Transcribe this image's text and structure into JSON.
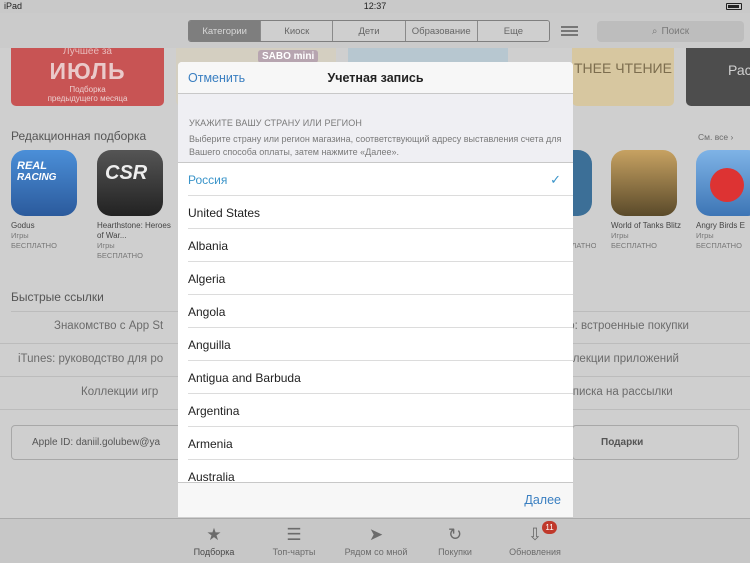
{
  "status": {
    "device": "iPad",
    "time": "12:37"
  },
  "nav": {
    "segments": [
      "Категории",
      "Киоск",
      "Дети",
      "Образование",
      "Еще"
    ],
    "active_segment": 0,
    "search_placeholder": "Поиск"
  },
  "banners": {
    "red_top": "Лучшее за",
    "red_title": "ИЮЛЬ",
    "red_sub1": "Подборка",
    "red_sub2": "предыдущего месяца",
    "sabo": "SABO mini",
    "reading": "ТНЕЕ ЧТЕНИЕ",
    "far": "Рас"
  },
  "editors": {
    "title": "Редакционная подборка",
    "see_all": "См. все ›",
    "apps": [
      {
        "name": "Godus",
        "cat": "Игры",
        "price": "БЕСПЛАТНО",
        "color": "#3a74c4"
      },
      {
        "name": "Hearthstone: Heroes of War...",
        "cat": "Игры",
        "price": "БЕСПЛАТНО",
        "color": "#3b3b3b"
      },
      {
        "name": "World of Tanks Blitz",
        "cat": "Игры",
        "price": "БЕСПЛАТНО",
        "color": "#7a6a3c"
      },
      {
        "name": "Angry Birds E",
        "cat": "Игры",
        "price": "БЕСПЛАТНО",
        "color": "#5a8fc9"
      }
    ],
    "partial_cat": "ы",
    "partial_price": "ПЛАТНО"
  },
  "quick_links": {
    "title": "Быстрые ссылки",
    "left": [
      "Знакомство с App St",
      "iTunes: руководство для ро",
      "Коллекции игр"
    ],
    "right": [
      "ю: встроенные покупки",
      "ллекции приложений",
      "дписка на рассылки"
    ]
  },
  "account": {
    "apple_id": "Apple ID: daniil.golubew@ya",
    "gifts": "Подарки"
  },
  "tabs": [
    {
      "label": "Подборка",
      "icon": "★"
    },
    {
      "label": "Топ-чарты",
      "icon": "☰"
    },
    {
      "label": "Рядом со мной",
      "icon": "➤"
    },
    {
      "label": "Покупки",
      "icon": "↻"
    },
    {
      "label": "Обновления",
      "icon": "⇩",
      "badge": "11"
    }
  ],
  "modal": {
    "cancel": "Отменить",
    "title": "Учетная запись",
    "heading": "УКАЖИТЕ ВАШУ СТРАНУ ИЛИ РЕГИОН",
    "description": "Выберите страну или регион магазина, соответствующий адресу выставления счета для Вашего способа оплаты, затем нажмите «Далее».",
    "countries": [
      "Россия",
      "United States",
      "Albania",
      "Algeria",
      "Angola",
      "Anguilla",
      "Antigua and Barbuda",
      "Argentina",
      "Armenia",
      "Australia"
    ],
    "selected": "Россия",
    "next": "Далее"
  }
}
